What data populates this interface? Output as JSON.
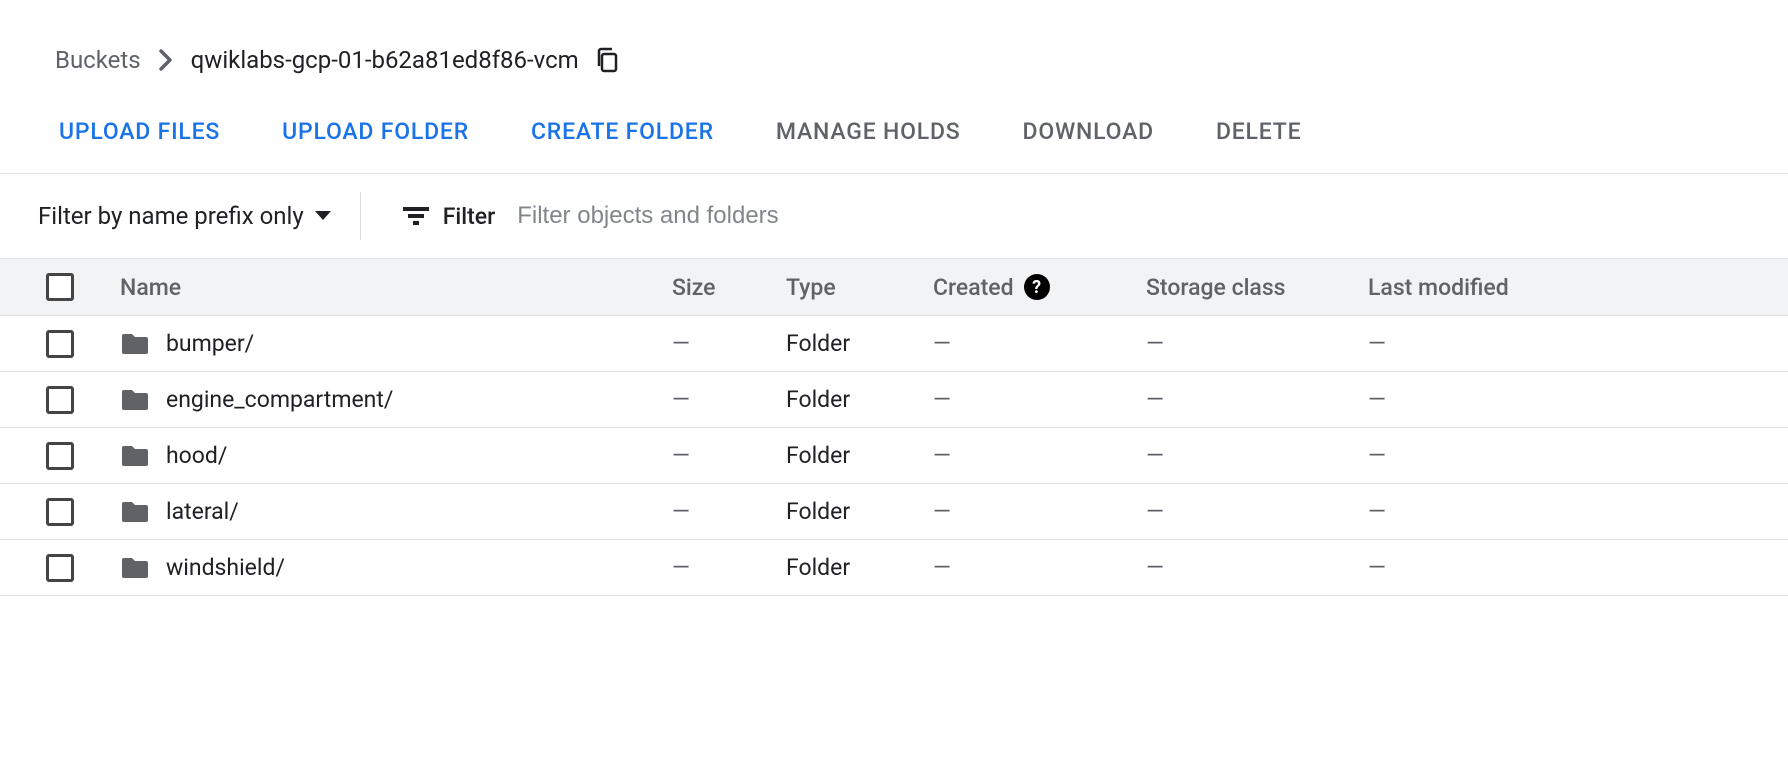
{
  "breadcrumb": {
    "root": "Buckets",
    "current": "qwiklabs-gcp-01-b62a81ed8f86-vcm"
  },
  "toolbar": {
    "upload_files": "UPLOAD FILES",
    "upload_folder": "UPLOAD FOLDER",
    "create_folder": "CREATE FOLDER",
    "manage_holds": "MANAGE HOLDS",
    "download": "DOWNLOAD",
    "delete": "DELETE"
  },
  "filter": {
    "mode_label": "Filter by name prefix only",
    "filter_word": "Filter",
    "placeholder": "Filter objects and folders"
  },
  "columns": {
    "name": "Name",
    "size": "Size",
    "type": "Type",
    "created": "Created",
    "storage": "Storage class",
    "modified": "Last modified"
  },
  "help_symbol": "?",
  "dash": "—",
  "rows": [
    {
      "name": "bumper/",
      "size": "—",
      "type": "Folder",
      "created": "—",
      "storage": "—",
      "modified": "—"
    },
    {
      "name": "engine_compartment/",
      "size": "—",
      "type": "Folder",
      "created": "—",
      "storage": "—",
      "modified": "—"
    },
    {
      "name": "hood/",
      "size": "—",
      "type": "Folder",
      "created": "—",
      "storage": "—",
      "modified": "—"
    },
    {
      "name": "lateral/",
      "size": "—",
      "type": "Folder",
      "created": "—",
      "storage": "—",
      "modified": "—"
    },
    {
      "name": "windshield/",
      "size": "—",
      "type": "Folder",
      "created": "—",
      "storage": "—",
      "modified": "—"
    }
  ]
}
